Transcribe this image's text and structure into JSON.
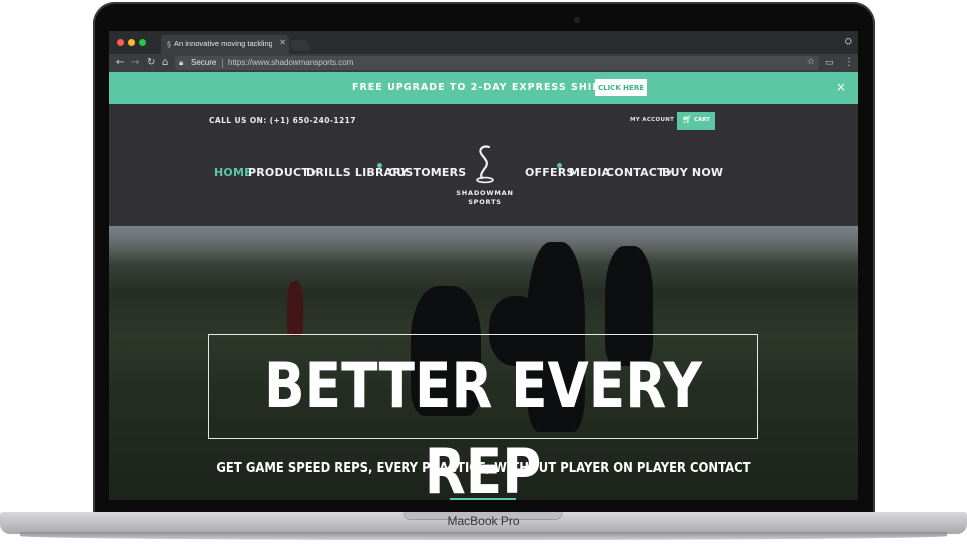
{
  "browser": {
    "tab_title": "An innovative moving tackling",
    "secure_label": "Secure",
    "url": "https://www.shadowmansports.com"
  },
  "promo": {
    "text": "FREE UPGRADE TO 2-DAY EXPRESS SHIPPING!",
    "button": "CLICK HERE",
    "close": "×"
  },
  "header": {
    "call": "CALL US ON: (+1) 650-240-1217",
    "my_account": "MY ACCOUNT",
    "cart": "CART"
  },
  "nav": {
    "home": "HOME",
    "product": "PRODUCT",
    "drills": "DRILLS LIBRARY",
    "customers": "CUSTOMERS",
    "offers": "OFFERS",
    "media": "MEDIA",
    "contact": "CONTACT",
    "buy": "BUY NOW"
  },
  "logo": {
    "line1": "SHADOWMAN",
    "line2": "SPORTS"
  },
  "hero": {
    "title": "BETTER EVERY REP",
    "subtitle": "GET GAME SPEED REPS, EVERY PRACTICE, WITHOUT PLAYER ON PLAYER CONTACT"
  },
  "device": {
    "label": "MacBook Pro"
  },
  "colors": {
    "accent": "#5cc7a3",
    "header_bg": "#323236"
  }
}
